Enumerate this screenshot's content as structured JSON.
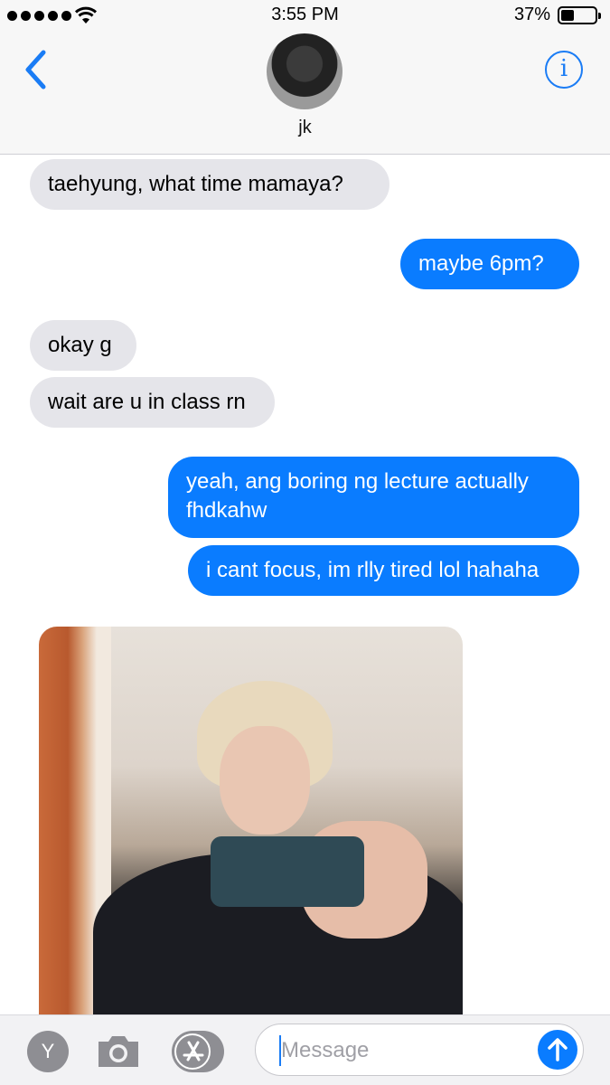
{
  "status_bar": {
    "time": "3:55 PM",
    "battery_percent": "37%",
    "signal_bars": 5,
    "wifi_icon": "wifi-icon",
    "battery_level": 0.37
  },
  "header": {
    "contact_name": "jk",
    "back_icon": "chevron-left-icon",
    "info_icon": "info-icon",
    "info_glyph": "i"
  },
  "messages": [
    {
      "direction": "incoming",
      "text": "taehyung, what time mamaya?"
    },
    {
      "direction": "outgoing",
      "text": "maybe 6pm?"
    },
    {
      "direction": "incoming",
      "text": "okay g"
    },
    {
      "direction": "incoming",
      "text": "wait are u in class rn"
    },
    {
      "direction": "outgoing",
      "text": "yeah, ang boring ng lecture actually fhdkahw"
    },
    {
      "direction": "outgoing",
      "text": "i cant focus, im rlly tired lol hahaha"
    },
    {
      "direction": "incoming",
      "type": "photo"
    }
  ],
  "composer": {
    "app_button_label": "Y",
    "camera_icon": "camera-icon",
    "app_store_icon": "app-store-icon",
    "placeholder": "Message",
    "send_icon": "arrow-up-icon"
  },
  "colors": {
    "accent": "#0a7cff",
    "incoming_bubble": "#e5e5ea",
    "outgoing_bubble": "#0a7cff"
  }
}
